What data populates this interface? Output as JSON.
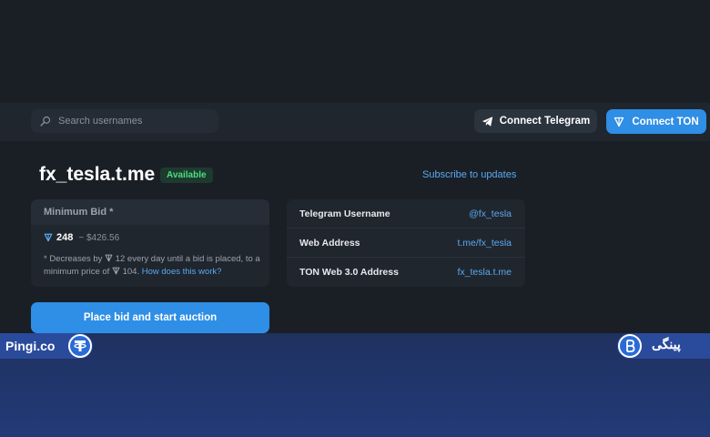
{
  "header": {
    "search_placeholder": "Search usernames",
    "connect_telegram": "Connect Telegram",
    "connect_ton": "Connect TON"
  },
  "listing": {
    "title": "fx_tesla.t.me",
    "status_badge": "Available",
    "subscribe_link": "Subscribe to updates"
  },
  "bid": {
    "heading": "Minimum Bid *",
    "value": "248",
    "usd": "~ $426.56",
    "note_prefix": "* Decreases by",
    "note_decrease": "12 every day until a bid is placed, to a minimum price of",
    "note_min": "104.",
    "note_link": "How does this work?",
    "place_button": "Place bid and start auction"
  },
  "info": {
    "rows": [
      {
        "label": "Telegram Username",
        "value": "@fx_tesla"
      },
      {
        "label": "Web Address",
        "value": "t.me/fx_tesla"
      },
      {
        "label": "TON Web 3.0 Address",
        "value": "fx_tesla.t.me"
      }
    ]
  },
  "watermark": {
    "left_text": "Pingi.co",
    "right_text": "پینگی"
  },
  "colors": {
    "accent": "#2f8ee5",
    "link": "#5aa9f0",
    "available": "#4ade80",
    "background": "#1a1f26"
  }
}
